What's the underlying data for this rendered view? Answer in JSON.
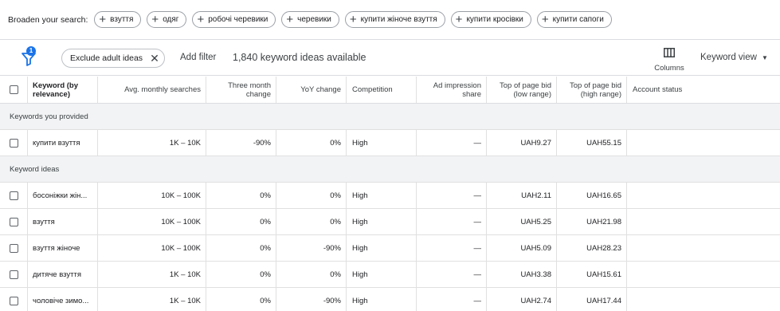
{
  "broaden": {
    "label": "Broaden your search:",
    "chips": [
      "взуття",
      "одяг",
      "робочі черевики",
      "черевики",
      "купити жіноче взуття",
      "купити кросівки",
      "купити сапоги"
    ]
  },
  "filterbar": {
    "badge": "1",
    "exclude_chip": "Exclude adult ideas",
    "add_filter": "Add filter",
    "ideas_count": "1,840 keyword ideas available",
    "columns_label": "Columns",
    "keyword_view": "Keyword view"
  },
  "table": {
    "headers": {
      "keyword": "Keyword (by relevance)",
      "avg": "Avg. monthly searches",
      "three": "Three month change",
      "yoy": "YoY change",
      "competition": "Competition",
      "impression": "Ad impression share",
      "bid_low": "Top of page bid (low range)",
      "bid_high": "Top of page bid (high range)",
      "status": "Account status"
    },
    "group_provided": "Keywords you provided",
    "group_ideas": "Keyword ideas",
    "provided": [
      {
        "keyword": "купити взуття",
        "avg": "1K – 10K",
        "three": "-90%",
        "yoy": "0%",
        "competition": "High",
        "impression": "—",
        "bid_low": "UAH9.27",
        "bid_high": "UAH55.15",
        "status": ""
      }
    ],
    "ideas": [
      {
        "keyword": "босоніжки жін...",
        "avg": "10K – 100K",
        "three": "0%",
        "yoy": "0%",
        "competition": "High",
        "impression": "—",
        "bid_low": "UAH2.11",
        "bid_high": "UAH16.65",
        "status": ""
      },
      {
        "keyword": "взуття",
        "avg": "10K – 100K",
        "three": "0%",
        "yoy": "0%",
        "competition": "High",
        "impression": "—",
        "bid_low": "UAH5.25",
        "bid_high": "UAH21.98",
        "status": ""
      },
      {
        "keyword": "взуття жіноче",
        "avg": "10K – 100K",
        "three": "0%",
        "yoy": "-90%",
        "competition": "High",
        "impression": "—",
        "bid_low": "UAH5.09",
        "bid_high": "UAH28.23",
        "status": ""
      },
      {
        "keyword": "дитяче взуття",
        "avg": "1K – 10K",
        "three": "0%",
        "yoy": "0%",
        "competition": "High",
        "impression": "—",
        "bid_low": "UAH3.38",
        "bid_high": "UAH15.61",
        "status": ""
      },
      {
        "keyword": "чоловіче зимо...",
        "avg": "1K – 10K",
        "three": "0%",
        "yoy": "-90%",
        "competition": "High",
        "impression": "—",
        "bid_low": "UAH2.74",
        "bid_high": "UAH17.44",
        "status": ""
      }
    ]
  }
}
